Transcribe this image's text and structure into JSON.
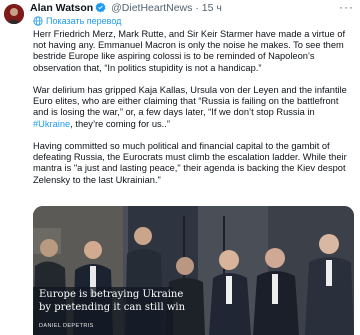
{
  "tweet": {
    "author": {
      "name": "Alan Watson",
      "handle": "@DietHeartNews",
      "verified": true,
      "avatar_color": "#8a1f1f"
    },
    "time": "15 ч",
    "dot": "·",
    "translate_label": "Показать перевод",
    "paragraphs": [
      {
        "text": "Herr Friedrich Merz, Mark Rutte, and Sir Keir Starmer have made a virtue of not having any. Emmanuel Macron is only the noise he makes. To see them bestride Europe like aspiring colossi is to be reminded of Napoleon’s observation that, “In politics stupidity is not a handicap.”"
      },
      {
        "text_before": "War delirium has gripped Kaja Kallas, Ursula von der Leyen and the infantile Euro elites, who are either claiming that “Russia is failing on the battlefront and is losing the war,” or, a few days later, “If we don’t stop Russia in ",
        "hashtag": "#Ukraine",
        "text_after": ", they’re coming for us..”"
      },
      {
        "text": "Having committed so much political and financial capital to the gambit of defeating Russia, the Eurocrats must climb the escalation ladder. While their mantra is \"a just and lasting peace,\" their agenda is backing the Kiev despot Zelensky to the last Ukrainian.\""
      }
    ],
    "media": {
      "caption_line1": "Europe is betraying Ukraine",
      "caption_line2": "by pretending it can still win",
      "byline": "DANIEL DEPETRIS"
    },
    "colors": {
      "link": "#1d9bf0",
      "text": "#0f1419",
      "muted": "#536471",
      "verified": "#1d9bf0"
    },
    "icons": [
      "verified-badge-icon",
      "more-options-icon",
      "globe-icon"
    ]
  }
}
